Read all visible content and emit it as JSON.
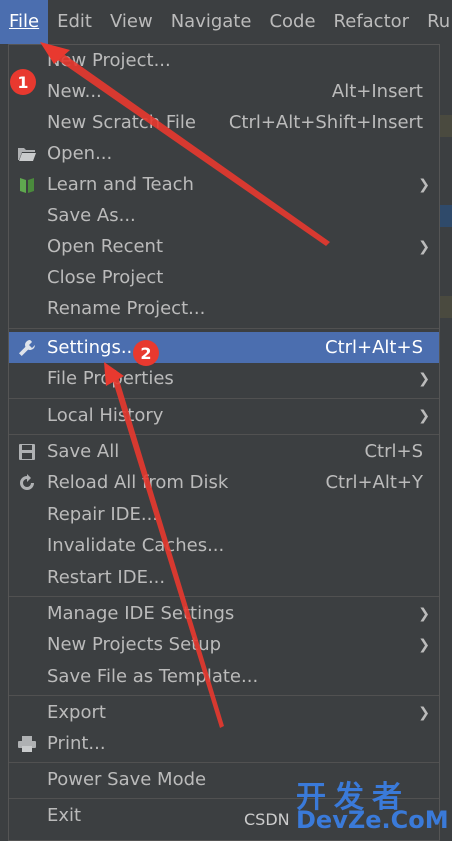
{
  "menubar": {
    "items": [
      {
        "label": "File"
      },
      {
        "label": "Edit"
      },
      {
        "label": "View"
      },
      {
        "label": "Navigate"
      },
      {
        "label": "Code"
      },
      {
        "label": "Refactor"
      },
      {
        "label": "Ru"
      }
    ]
  },
  "file_menu": {
    "items": [
      {
        "label": "New Project...",
        "shortcut": "",
        "submenu": false,
        "icon": ""
      },
      {
        "label": "New...",
        "shortcut": "Alt+Insert",
        "submenu": false,
        "icon": ""
      },
      {
        "label": "New Scratch File",
        "shortcut": "Ctrl+Alt+Shift+Insert",
        "submenu": false,
        "icon": ""
      },
      {
        "label": "Open...",
        "shortcut": "",
        "submenu": false,
        "icon": "folder-icon"
      },
      {
        "label": "Learn and Teach",
        "shortcut": "",
        "submenu": true,
        "icon": "book-icon"
      },
      {
        "label": "Save As...",
        "shortcut": "",
        "submenu": false,
        "icon": ""
      },
      {
        "label": "Open Recent",
        "shortcut": "",
        "submenu": true,
        "icon": ""
      },
      {
        "label": "Close Project",
        "shortcut": "",
        "submenu": false,
        "icon": ""
      },
      {
        "label": "Rename Project...",
        "shortcut": "",
        "submenu": false,
        "icon": ""
      },
      {
        "label": "Settings...",
        "shortcut": "Ctrl+Alt+S",
        "submenu": false,
        "icon": "wrench-icon",
        "selected": true
      },
      {
        "label": "File Properties",
        "shortcut": "",
        "submenu": true,
        "icon": ""
      },
      {
        "label": "Local History",
        "shortcut": "",
        "submenu": true,
        "icon": ""
      },
      {
        "label": "Save All",
        "shortcut": "Ctrl+S",
        "submenu": false,
        "icon": "save-icon"
      },
      {
        "label": "Reload All from Disk",
        "shortcut": "Ctrl+Alt+Y",
        "submenu": false,
        "icon": "reload-icon"
      },
      {
        "label": "Repair IDE...",
        "shortcut": "",
        "submenu": false,
        "icon": ""
      },
      {
        "label": "Invalidate Caches...",
        "shortcut": "",
        "submenu": false,
        "icon": ""
      },
      {
        "label": "Restart IDE...",
        "shortcut": "",
        "submenu": false,
        "icon": ""
      },
      {
        "label": "Manage IDE Settings",
        "shortcut": "",
        "submenu": true,
        "icon": ""
      },
      {
        "label": "New Projects Setup",
        "shortcut": "",
        "submenu": true,
        "icon": ""
      },
      {
        "label": "Save File as Template...",
        "shortcut": "",
        "submenu": false,
        "icon": ""
      },
      {
        "label": "Export",
        "shortcut": "",
        "submenu": true,
        "icon": ""
      },
      {
        "label": "Print...",
        "shortcut": "",
        "submenu": false,
        "icon": "printer-icon"
      },
      {
        "label": "Power Save Mode",
        "shortcut": "",
        "submenu": false,
        "icon": ""
      },
      {
        "label": "Exit",
        "shortcut": "",
        "submenu": false,
        "icon": ""
      }
    ]
  },
  "annotations": {
    "badge1": "1",
    "badge2": "2"
  },
  "watermark": {
    "cn": "开发者",
    "site": "DevZe.CoM",
    "csdn": "CSDN"
  },
  "colors": {
    "menu_bg": "#3c3f41",
    "selection": "#4b6eaf",
    "annotation_red": "#e8392f"
  }
}
